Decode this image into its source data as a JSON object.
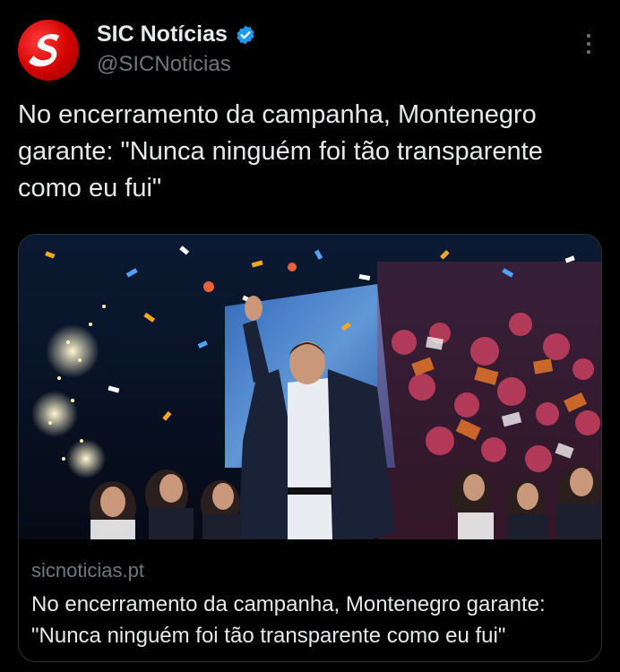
{
  "account": {
    "display_name": "SIC Notícias",
    "handle": "@SICNoticias",
    "avatar_icon": "sic-logo-icon",
    "verified_icon": "verified-badge-icon",
    "verified_color": "#1d9bf0",
    "avatar_color": "#d10000"
  },
  "menu": {
    "icon": "more-vertical-icon"
  },
  "tweet": {
    "text": "No encerramento da campanha, Montenegro garante: \"Nunca ninguém foi tão transparente como eu fui\""
  },
  "link_card": {
    "image_icon": "campaign-rally-photo",
    "domain": "sicnoticias.pt",
    "title": "No encerramento da campanha, Montenegro garante: \"Nunca ninguém foi tão transparente como eu fui\""
  },
  "colors": {
    "background": "#000000",
    "primary_text": "#e7e9ea",
    "secondary_text": "#71767b",
    "border": "#2f3336"
  }
}
